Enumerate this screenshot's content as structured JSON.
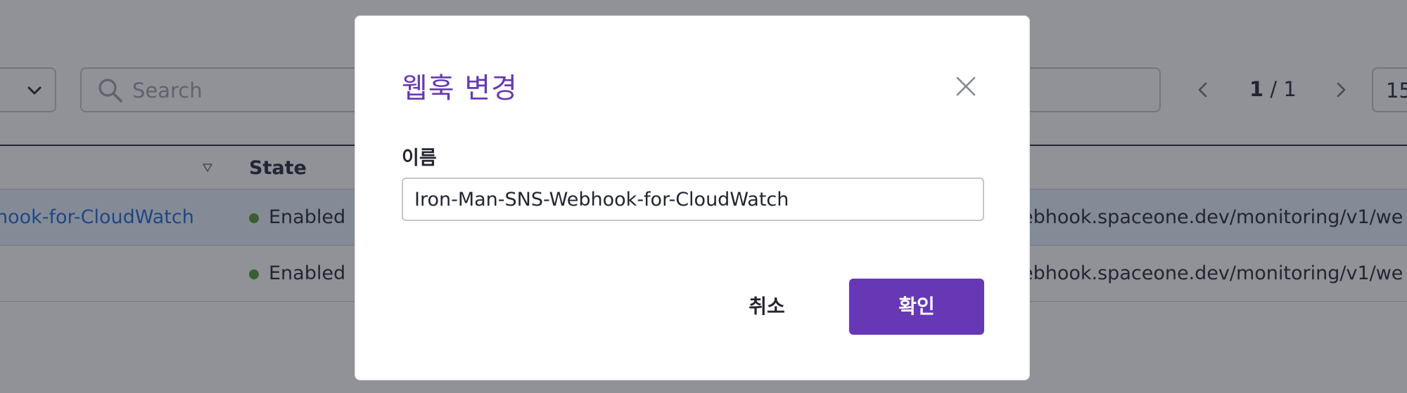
{
  "toolbar": {
    "search_placeholder": "Search",
    "pagination": {
      "current": "1",
      "separator": " / ",
      "total": "1"
    },
    "page_size": "15"
  },
  "table": {
    "columns": {
      "state": "State"
    },
    "rows": [
      {
        "name": "hook-for-CloudWatch",
        "state": "Enabled",
        "url": "ebhook.spaceone.dev/monitoring/v1/we"
      },
      {
        "name": "",
        "state": "Enabled",
        "url": "ebhook.spaceone.dev/monitoring/v1/we"
      }
    ]
  },
  "modal": {
    "title": "웹훅 변경",
    "name_label": "이름",
    "name_value": "Iron-Man-SNS-Webhook-for-CloudWatch",
    "cancel_label": "취소",
    "confirm_label": "확인"
  },
  "colors": {
    "primary": "#6638b6",
    "link": "#1d68d8",
    "status_enabled": "#4e9a2f",
    "selected_row": "#e9f1fb"
  },
  "icons": [
    "chevron-down-icon",
    "search-icon",
    "chevron-left-icon",
    "chevron-right-icon",
    "sort-icon",
    "close-icon"
  ]
}
